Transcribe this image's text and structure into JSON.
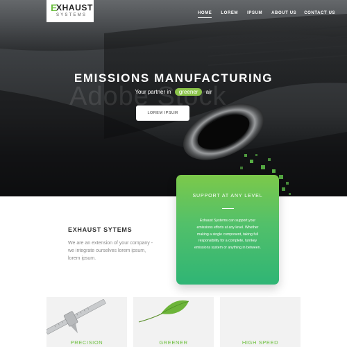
{
  "brand": {
    "logo_letter": "E",
    "logo_word": "XHAUST",
    "logo_sub": "SYSTEMS"
  },
  "nav": {
    "items": [
      {
        "label": "HOME",
        "active": true
      },
      {
        "label": "LOREM",
        "active": false
      },
      {
        "label": "IPSUM",
        "active": false
      },
      {
        "label": "ABOUT US",
        "active": false
      },
      {
        "label": "CONTACT US",
        "active": false
      }
    ]
  },
  "hero": {
    "title": "EMISSIONS MANUFACTURING",
    "tagline_prefix": "Your partner in",
    "tagline_highlight": "greener",
    "tagline_suffix": "air",
    "button_label": "LOREM IPSUM",
    "watermark": "Adobe Stock"
  },
  "support": {
    "title": "SUPPORT AT ANY LEVEL",
    "text": "Exhaust Systems can support your emissions efforts at any level. Whether making a single component, taking full responsibility for a complete, turnkey emissions system or anything in between."
  },
  "about": {
    "heading": "EXHAUST SYTEMS",
    "text": "We are an extension of your company - we integrate ourselves lorem ipsum, lorem ipsum."
  },
  "features": [
    {
      "label": "PRECISION",
      "icon": "caliper-icon"
    },
    {
      "label": "GREENER",
      "icon": "leaf-icon"
    },
    {
      "label": "HIGH SPEED",
      "icon": "speed-icon"
    }
  ],
  "colors": {
    "accent_green": "#6bbf3f",
    "card_gradient_top": "#7cc94a",
    "card_gradient_bottom": "#2fb575",
    "hero_dark": "#17191b"
  }
}
